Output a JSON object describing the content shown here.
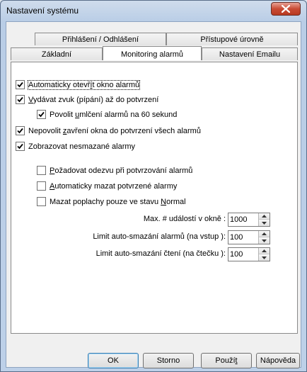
{
  "window": {
    "title": "Nastavení systému",
    "close_icon": "close-icon"
  },
  "tabs": {
    "row1": [
      {
        "label": "Přihlášení / Odhlášení"
      },
      {
        "label": "Přístupové úrovně"
      }
    ],
    "row2": [
      {
        "label": "Základní"
      },
      {
        "label": "Monitoring alarmů",
        "active": true
      },
      {
        "label": "Nastavení Emailu"
      }
    ]
  },
  "options": [
    {
      "pre": "Automaticky otevř",
      "ul": "í",
      "post": "t okno alarmů",
      "checked": true
    },
    {
      "pre": "",
      "ul": "V",
      "post": "ydávat zvuk (pípání) až do potvrzení",
      "checked": true
    },
    {
      "pre": "Povolit ",
      "ul": "u",
      "post": "mlčení alarmů na 60 sekund",
      "checked": true
    },
    {
      "pre": "Nepovolit ",
      "ul": "z",
      "post": "avření okna do potvrzení všech alarmů",
      "checked": true
    },
    {
      "pre": "Zobrazovat nesmazané alarmy",
      "ul": "",
      "post": "",
      "checked": true
    },
    {
      "pre": "",
      "ul": "P",
      "post": "ožadovat odezvu při potvrzování alarmů",
      "checked": false
    },
    {
      "pre": "",
      "ul": "A",
      "post": "utomaticky mazat potvrzené alarmy",
      "checked": false
    },
    {
      "pre": "Mazat poplachy pouze ve stavu ",
      "ul": "N",
      "post": "ormal",
      "checked": false
    }
  ],
  "fields": {
    "max_events_label": "Max. # událostí v okně :",
    "max_events_value": "1000",
    "auto_delete_alarms_label": "Limit auto-smazání alarmů (na vstup ):",
    "auto_delete_alarms_value": "100",
    "auto_delete_reads_label": "Limit auto-smazání čtení (na čtečku ):",
    "auto_delete_reads_value": "100"
  },
  "buttons": {
    "ok": "OK",
    "cancel": "Storno",
    "apply_pre": "Použí",
    "apply_ul": "t",
    "help": "Nápověda"
  },
  "colors": {
    "close_button": "#c94b34",
    "title_bar": "#bdd0e8"
  }
}
